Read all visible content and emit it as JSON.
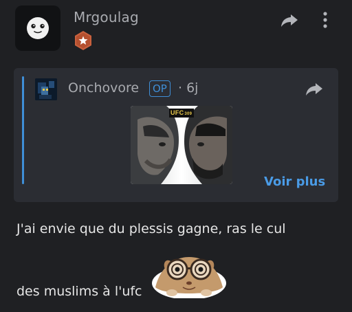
{
  "post": {
    "username": "Mrgoulag",
    "rank_badge_icon": "star-badge-icon",
    "share_icon": "share-arrow-icon",
    "more_icon": "more-vertical-icon",
    "text_line1": "J'ai envie que du plessis gagne, ras le cul",
    "text_line2": "des muslims à l'ufc"
  },
  "quote": {
    "username": "Onchovore",
    "op_badge": "OP",
    "separator": "·",
    "time": "6j",
    "thumbnail_logo": "UFC",
    "thumbnail_logo_sub": "309",
    "voir_plus": "Voir plus",
    "share_icon": "share-arrow-icon"
  },
  "colors": {
    "background": "#1f2023",
    "quote_background": "#2b2d33",
    "accent_blue": "#3f8fd8",
    "link_blue": "#4a9be6",
    "badge_orange": "#c9613e",
    "muted_text": "#a9abb0"
  }
}
